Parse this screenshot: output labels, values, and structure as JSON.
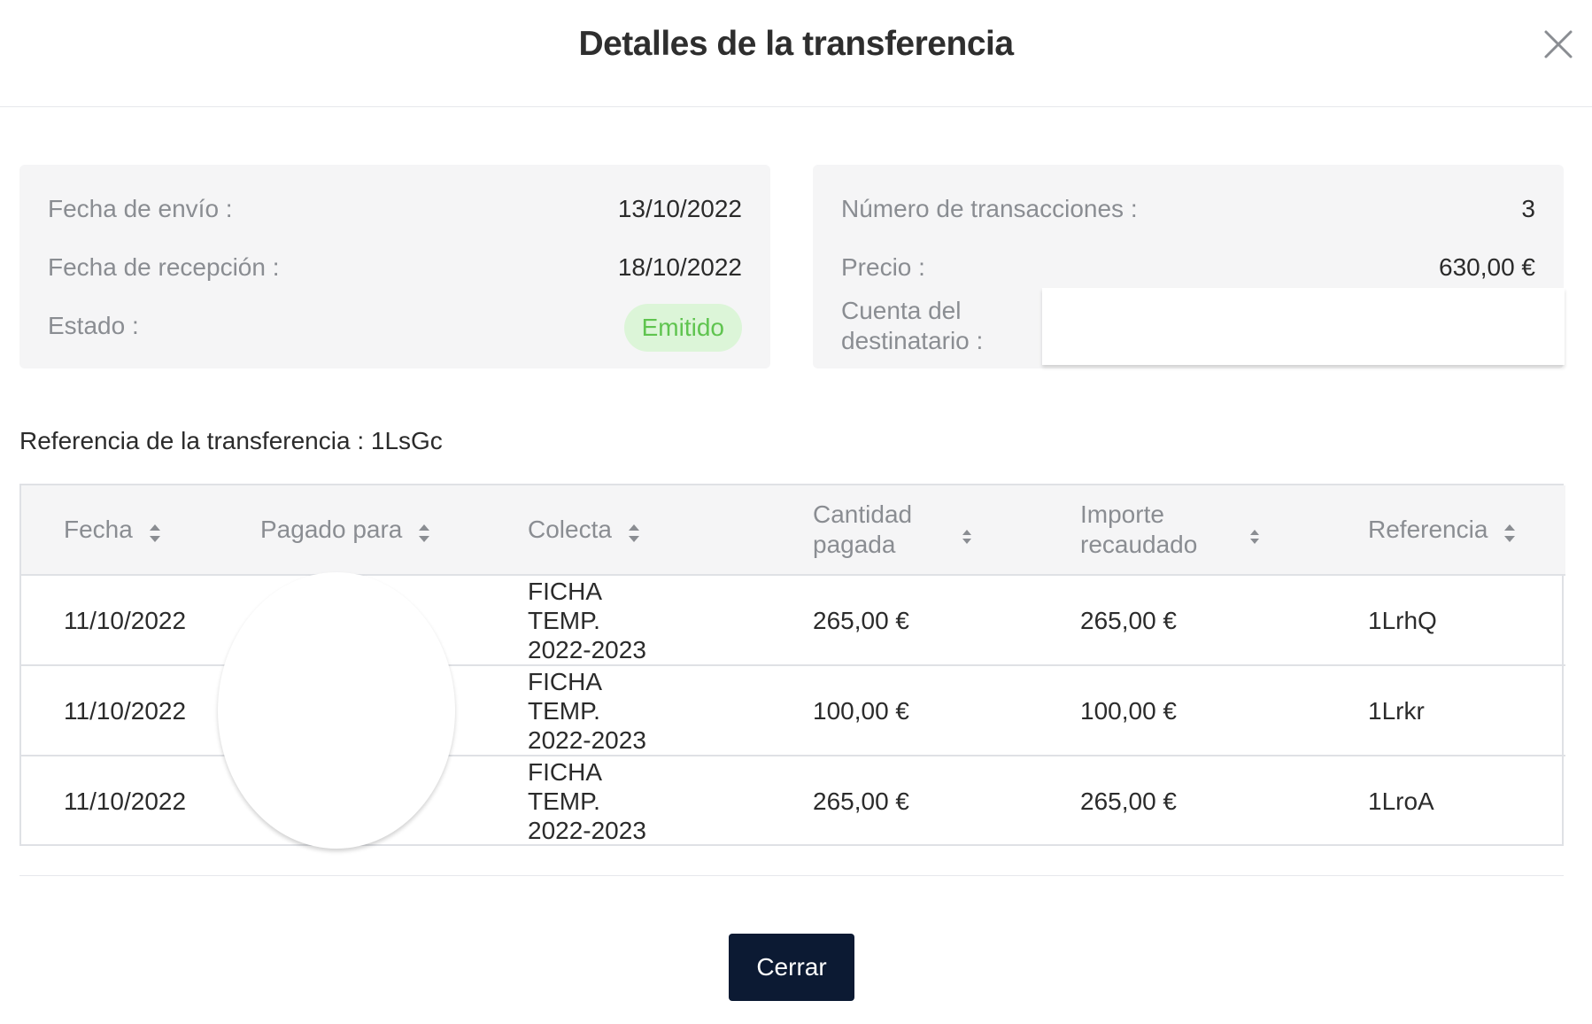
{
  "dialog": {
    "title": "Detalles de la transferencia"
  },
  "summary_left": {
    "send_date_label": "Fecha de envío :",
    "send_date": "13/10/2022",
    "receive_date_label": "Fecha de recepción :",
    "receive_date": "18/10/2022",
    "status_label": "Estado :",
    "status": "Emitido"
  },
  "summary_right": {
    "transactions_label": "Número de transacciones :",
    "transactions": "3",
    "price_label": "Precio :",
    "price": "630,00 €",
    "account_label": "Cuenta del destinatario :"
  },
  "reference_line": "Referencia de la transferencia : 1LsGc",
  "table": {
    "headers": [
      "Fecha",
      "Pagado para",
      "Colecta",
      "Cantidad pagada",
      "Importe recaudado",
      "Referencia"
    ],
    "rows": [
      {
        "date": "11/10/2022",
        "paid_for": "",
        "collection": "FICHA TEMP. 2022-2023",
        "amount_paid": "265,00 €",
        "amount_collected": "265,00 €",
        "reference": "1LrhQ"
      },
      {
        "date": "11/10/2022",
        "paid_for": "",
        "collection": "FICHA TEMP. 2022-2023",
        "amount_paid": "100,00 €",
        "amount_collected": "100,00 €",
        "reference": "1Lrkr"
      },
      {
        "date": "11/10/2022",
        "paid_for": "",
        "collection": "FICHA TEMP. 2022-2023",
        "amount_paid": "265,00 €",
        "amount_collected": "265,00 €",
        "reference": "1LroA"
      }
    ]
  },
  "footer": {
    "close_label": "Cerrar"
  },
  "colors": {
    "status_bg": "#dcf5d8",
    "status_text": "#5fc44f",
    "primary_button": "#0c1a33"
  },
  "icons": {
    "close": "close-icon",
    "sort": "sort-icon"
  }
}
